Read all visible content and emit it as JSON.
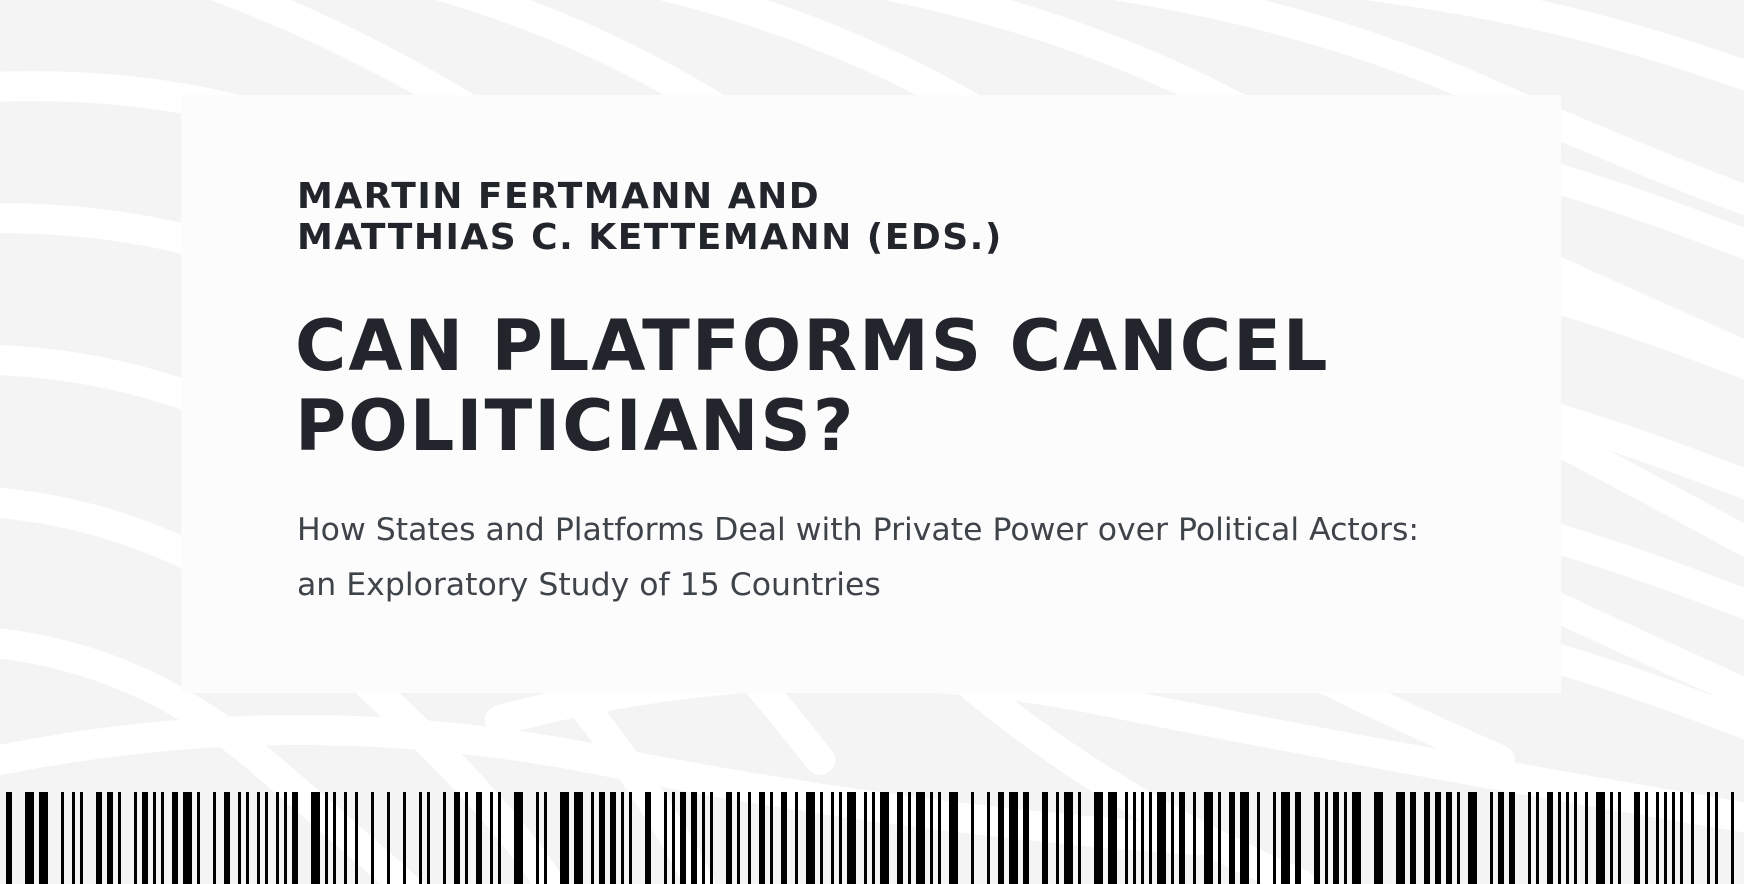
{
  "book": {
    "authors_line1": "MARTIN FERTMANN AND",
    "authors_line2": "MATTHIAS C. KETTEMANN (EDS.)",
    "title_line1": "CAN PLATFORMS CANCEL",
    "title_line2": "POLITICIANS?",
    "subtitle_line1": "How States and Platforms Deal with Private Power over Political Actors:",
    "subtitle_line2": "an Exploratory Study of 15 Countries"
  },
  "colors": {
    "text_dark": "#22252b",
    "text_subtitle": "#3f434a",
    "background": "#f4f4f4",
    "barcode": "#000000"
  }
}
